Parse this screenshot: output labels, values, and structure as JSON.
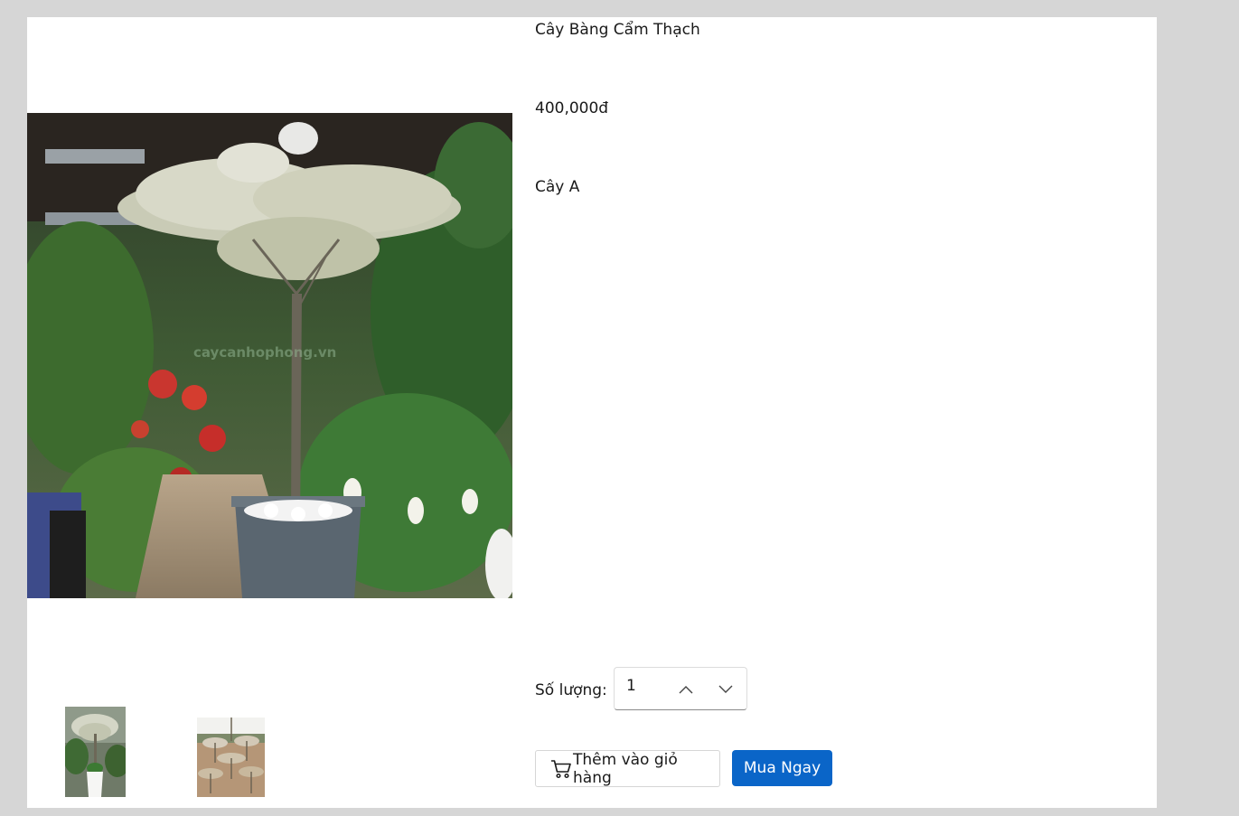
{
  "product": {
    "title": "Cây Bàng Cẩm Thạch",
    "price": "400,000đ",
    "category": "Cây A",
    "watermark": "caycanhophong.vn"
  },
  "quantity": {
    "label": "Số lượng:",
    "value": "1"
  },
  "actions": {
    "add_to_cart_label": "Thêm vào giỏ hàng",
    "buy_now_label": "Mua Ngay"
  },
  "icons": {
    "cart": "cart-icon",
    "increment": "chevron-up-icon",
    "decrement": "chevron-down-icon"
  },
  "colors": {
    "primary": "#0a65c8",
    "page_background": "#d6d6d6",
    "panel_background": "#ffffff"
  }
}
